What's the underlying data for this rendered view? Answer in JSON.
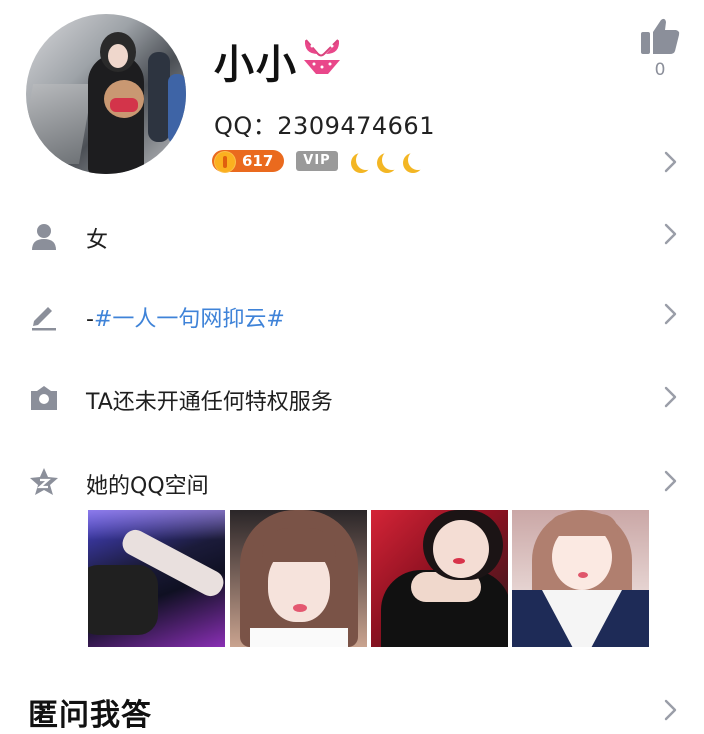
{
  "profile": {
    "nickname": "小小",
    "qq_number": "QQ：2309474661",
    "level": "617",
    "vip_label": "VIP",
    "like_count": "0"
  },
  "rows": [
    {
      "icon": "person-icon",
      "label": "女"
    },
    {
      "icon": "pencil-icon",
      "label_prefix": "-",
      "label_tag": "#一人一句网抑云#"
    },
    {
      "icon": "privilege-icon",
      "label": "TA还未开通任何特权服务"
    },
    {
      "icon": "star-icon",
      "label": "她的QQ空间"
    }
  ],
  "qzone_photos": [
    "photo-1",
    "photo-2",
    "photo-3",
    "photo-4"
  ],
  "qa_section": {
    "title": "匿问我答"
  },
  "colors": {
    "accent_blue": "#3f83d8",
    "level_orange": "#ea6a1e",
    "icon_gray": "#8b8f9a",
    "moon_yellow": "#f3b624"
  }
}
